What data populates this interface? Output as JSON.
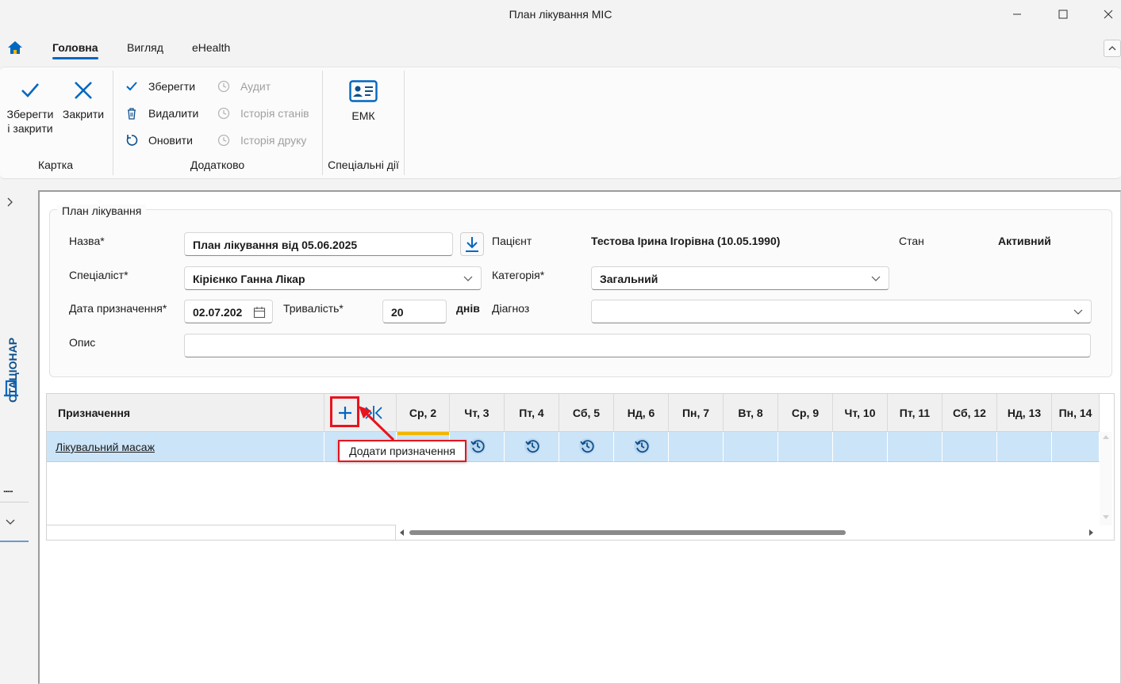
{
  "window": {
    "title": "План лікування МІС",
    "minimize": "—",
    "maximize": "☐",
    "close": "✕"
  },
  "menu": {
    "tabs": [
      {
        "label": "Головна",
        "active": true
      },
      {
        "label": "Вигляд",
        "active": false
      },
      {
        "label": "eHealth",
        "active": false
      }
    ],
    "collapse_icon": "chevron-up-icon"
  },
  "ribbon": {
    "kartka": {
      "save_close_label": "Зберегти і закрити",
      "save_close_line1": "Зберегти",
      "save_close_line2": "і закрити",
      "close_label": "Закрити",
      "group_label": "Картка"
    },
    "dodatkovo": {
      "save_label": "Зберегти",
      "delete_label": "Видалити",
      "refresh_label": "Оновити",
      "audit_label": "Аудит",
      "state_history_label": "Історія станів",
      "print_history_label": "Історія друку",
      "group_label": "Додатково"
    },
    "special": {
      "emk_label": "ЕМК",
      "group_label": "Спеціальні дії"
    }
  },
  "sidepanel": {
    "vertical_label": "СТАЦІОНАР",
    "dots": "....."
  },
  "form": {
    "legend": "План лікування",
    "name_label": "Назва*",
    "name_value": "План лікування від 05.06.2025",
    "patient_label": "Пацієнт",
    "patient_value": "Тестова Ірина Ігорівна (10.05.1990)",
    "state_label": "Стан",
    "state_value": "Активний",
    "specialist_label": "Спеціаліст*",
    "specialist_value": "Кірієнко Ганна Лікар",
    "category_label": "Категорія*",
    "category_value": "Загальний",
    "date_label": "Дата призначення*",
    "date_value": "02.07.202",
    "duration_label": "Тривалість*",
    "duration_value": "20",
    "duration_unit": "днів",
    "diagnosis_label": "Діагноз",
    "diagnosis_value": "",
    "description_label": "Опис",
    "description_value": ""
  },
  "grid": {
    "first_col_header": "Призначення",
    "day_headers": [
      "Ср, 2",
      "Чт, 3",
      "Пт, 4",
      "Сб, 5",
      "Нд, 6",
      "Пн, 7",
      "Вт, 8",
      "Ср, 9",
      "Чт, 10",
      "Пт, 11",
      "Сб, 12",
      "Нд, 13",
      "Пн, 14"
    ],
    "rows": [
      {
        "name": "Лікувальний масаж",
        "scheduled_days": [
          "Чт, 3",
          "Пт, 4",
          "Сб, 5",
          "Нд, 6"
        ]
      }
    ],
    "tooltip": "Додати призначення"
  },
  "colors": {
    "accent": "#0067c0",
    "highlight": "#e8141e",
    "row_selected": "#cce4f7",
    "today_marker": "#f2b700",
    "brand_dark": "#0d4f8b"
  }
}
